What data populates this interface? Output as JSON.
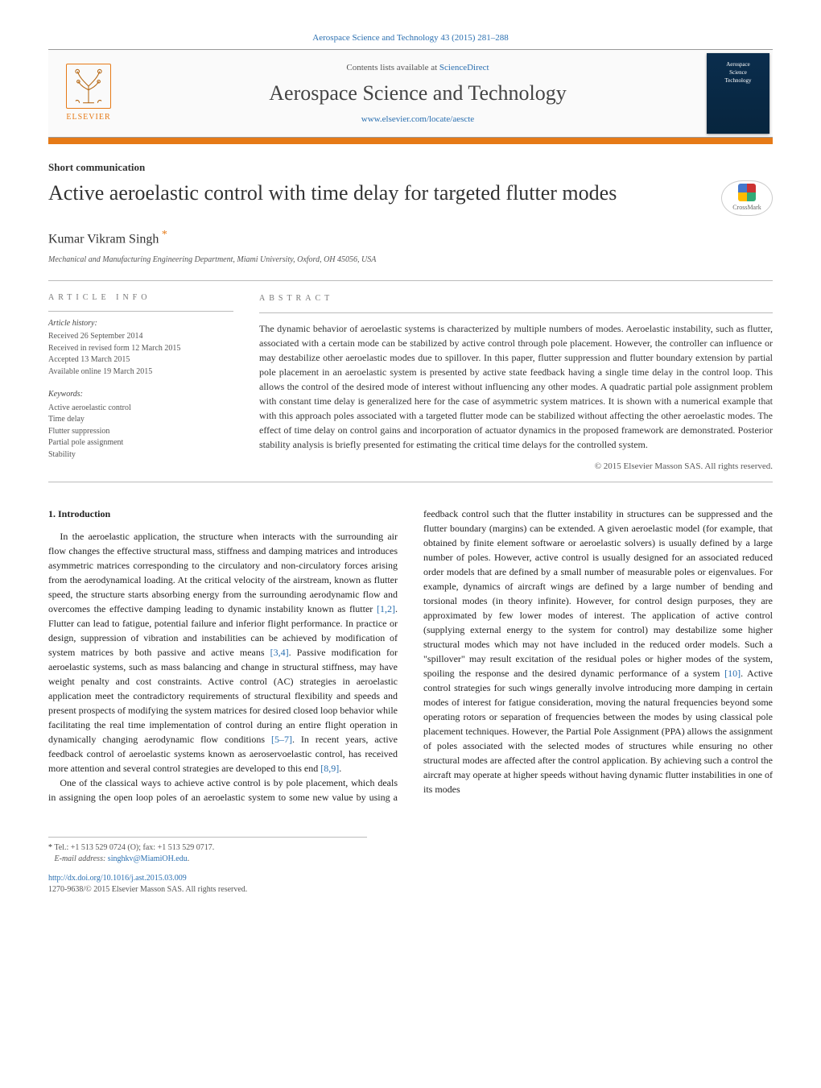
{
  "citation": "Aerospace Science and Technology 43 (2015) 281–288",
  "masthead": {
    "publisher": "ELSEVIER",
    "contents_prefix": "Contents lists available at ",
    "contents_link": "ScienceDirect",
    "journal": "Aerospace Science and Technology",
    "journal_url": "www.elsevier.com/locate/aescte",
    "cover_line1": "Aerospace",
    "cover_line2": "Science",
    "cover_line3": "Technology"
  },
  "article": {
    "type": "Short communication",
    "title": "Active aeroelastic control with time delay for targeted flutter modes",
    "crossmark": "CrossMark",
    "author": "Kumar Vikram Singh",
    "affiliation": "Mechanical and Manufacturing Engineering Department, Miami University, Oxford, OH 45056, USA"
  },
  "info": {
    "heading": "ARTICLE INFO",
    "history_label": "Article history:",
    "received": "Received 26 September 2014",
    "revised": "Received in revised form 12 March 2015",
    "accepted": "Accepted 13 March 2015",
    "online": "Available online 19 March 2015",
    "keywords_label": "Keywords:",
    "keywords": [
      "Active aeroelastic control",
      "Time delay",
      "Flutter suppression",
      "Partial pole assignment",
      "Stability"
    ]
  },
  "abstract": {
    "heading": "ABSTRACT",
    "text": "The dynamic behavior of aeroelastic systems is characterized by multiple numbers of modes. Aeroelastic instability, such as flutter, associated with a certain mode can be stabilized by active control through pole placement. However, the controller can influence or may destabilize other aeroelastic modes due to spillover. In this paper, flutter suppression and flutter boundary extension by partial pole placement in an aeroelastic system is presented by active state feedback having a single time delay in the control loop. This allows the control of the desired mode of interest without influencing any other modes. A quadratic partial pole assignment problem with constant time delay is generalized here for the case of asymmetric system matrices. It is shown with a numerical example that with this approach poles associated with a targeted flutter mode can be stabilized without affecting the other aeroelastic modes. The effect of time delay on control gains and incorporation of actuator dynamics in the proposed framework are demonstrated. Posterior stability analysis is briefly presented for estimating the critical time delays for the controlled system.",
    "copyright": "© 2015 Elsevier Masson SAS. All rights reserved."
  },
  "body": {
    "section1_title": "1. Introduction",
    "p1a": "In the aeroelastic application, the structure when interacts with the surrounding air flow changes the effective structural mass, stiffness and damping matrices and introduces asymmetric matrices corresponding to the circulatory and non-circulatory forces arising from the aerodynamical loading. At the critical velocity of the airstream, known as flutter speed, the structure starts absorbing energy from the surrounding aerodynamic flow and overcomes the effective damping leading to dynamic instability known as flutter ",
    "ref12": "[1,2]",
    "p1b": ". Flutter can lead to fatigue, potential failure and inferior flight performance. In practice or design, suppression of vibration and instabilities can be achieved by modification of system matrices by both passive and active means ",
    "ref34": "[3,4]",
    "p1c": ". Passive modification for aeroelastic systems, such as mass balancing and change in structural stiffness, may have weight penalty and cost constraints. Active control (AC) strategies in aeroelastic application meet the contradictory requirements of structural flexibility and speeds and present prospects of modifying the system matrices for desired closed loop behavior while facilitating the real time implementation of control during an entire flight operation in dynamically changing aerodynamic flow conditions ",
    "ref57": "[5–7]",
    "p1d": ". In recent years, active feedback control of aeroelastic systems known as aeroservoelastic control, has received more attention and several control strategies are developed to this end ",
    "ref89": "[8,9]",
    "p1e": ".",
    "p2a": "One of the classical ways to achieve active control is by pole placement, which deals in assigning the open loop poles of an aeroelastic system to some new value by using a feedback control such that the flutter instability in structures can be suppressed and the flutter boundary (margins) can be extended. A given aeroelastic model (for example, that obtained by finite element software or aeroelastic solvers) is usually defined by a large number of poles. However, active control is usually designed for an associated reduced order models that are defined by a small number of measurable poles or eigenvalues. For example, dynamics of aircraft wings are defined by a large number of bending and torsional modes (in theory infinite). However, for control design purposes, they are approximated by few lower modes of interest. The application of active control (supplying external energy to the system for control) may destabilize some higher structural modes which may not have included in the reduced order models. Such a \"spillover\" may result excitation of the residual poles or higher modes of the system, spoiling the response and the desired dynamic performance of a system ",
    "ref10": "[10]",
    "p2b": ". Active control strategies for such wings generally involve introducing more damping in certain modes of interest for fatigue consideration, moving the natural frequencies beyond some operating rotors or separation of frequencies between the modes by using classical pole placement techniques. However, the Partial Pole Assignment (PPA) allows the assignment of poles associated with the selected modes of structures while ensuring no other structural modes are affected after the control application. By achieving such a control the aircraft may operate at higher speeds without having dynamic flutter instabilities in one of its modes"
  },
  "footnotes": {
    "tel": "Tel.: +1 513 529 0724 (O); fax: +1 513 529 0717.",
    "email_label": "E-mail address:",
    "email": "singhkv@MiamiOH.edu",
    "doi": "http://dx.doi.org/10.1016/j.ast.2015.03.009",
    "issn_line": "1270-9638/© 2015 Elsevier Masson SAS. All rights reserved."
  }
}
